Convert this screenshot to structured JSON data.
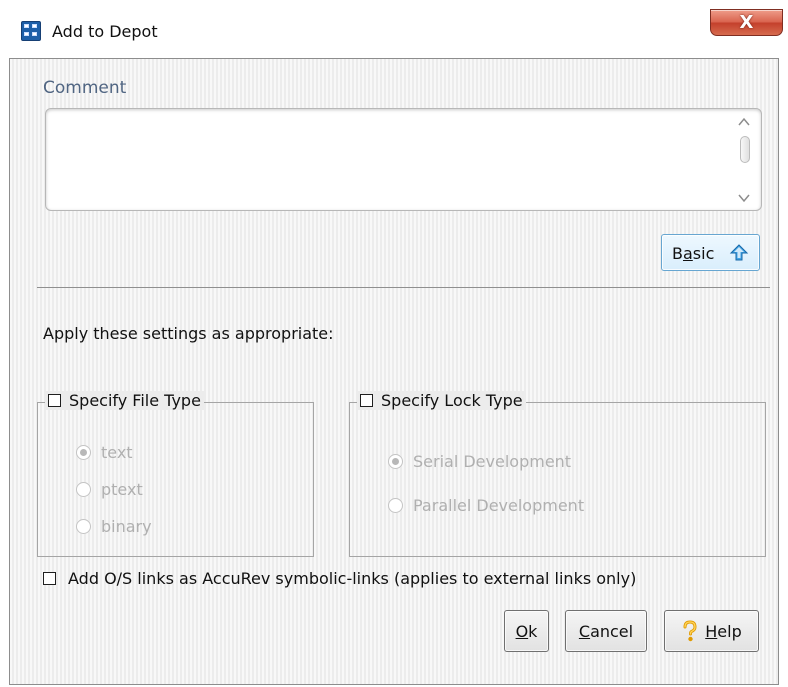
{
  "window": {
    "title": "Add to Depot",
    "close_label": "X"
  },
  "comment": {
    "label": "Comment",
    "value": "",
    "placeholder": ""
  },
  "basic_button": {
    "label_first": "B",
    "label_underlined": "a",
    "label_rest": "sic",
    "icon": "up-arrow-icon"
  },
  "apply_text": "Apply these settings as appropriate:",
  "file_type": {
    "title": "Specify File Type",
    "checked": false,
    "options": [
      {
        "label": "text",
        "selected": true
      },
      {
        "label": "ptext",
        "selected": false
      },
      {
        "label": "binary",
        "selected": false
      }
    ]
  },
  "lock_type": {
    "title": "Specify Lock Type",
    "checked": false,
    "options": [
      {
        "label": "Serial Development",
        "selected": true
      },
      {
        "label": "Parallel Development",
        "selected": false
      }
    ]
  },
  "symlink_option": {
    "label": "Add O/S links as AccuRev symbolic-links (applies to external links only)",
    "checked": false
  },
  "buttons": {
    "ok": {
      "prefix": "",
      "underlined": "O",
      "suffix": "k"
    },
    "cancel": {
      "prefix": "",
      "underlined": "C",
      "suffix": "ancel"
    },
    "help": {
      "prefix": "",
      "underlined": "H",
      "suffix": "elp",
      "icon": "question-icon"
    }
  },
  "colors": {
    "accent": "#67a6d1",
    "panel": "#ececec",
    "close_button": "#c4402c",
    "disabled_text": "#b0b0b0"
  }
}
